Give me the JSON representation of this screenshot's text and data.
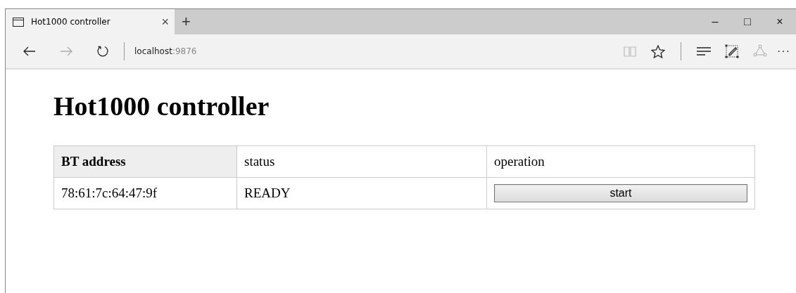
{
  "tabs": [
    {
      "title": "Hot1000 controller",
      "close": "×",
      "selected": true
    }
  ],
  "new_tab": "+",
  "window_controls": {
    "minimize": "–",
    "maximize": "□",
    "close": "×"
  },
  "address_bar": {
    "host": "localhost",
    "port": ":9876"
  },
  "toolbar": {
    "more": "···"
  },
  "page": {
    "heading": "Hot1000 controller",
    "table": {
      "columns": [
        {
          "label": "BT address",
          "kind": "th"
        },
        {
          "label": "status",
          "kind": "td"
        },
        {
          "label": "operation",
          "kind": "td"
        }
      ],
      "rows": [
        {
          "address": "78:61:7c:64:47:9f",
          "status": "READY",
          "action": "start"
        }
      ]
    }
  }
}
